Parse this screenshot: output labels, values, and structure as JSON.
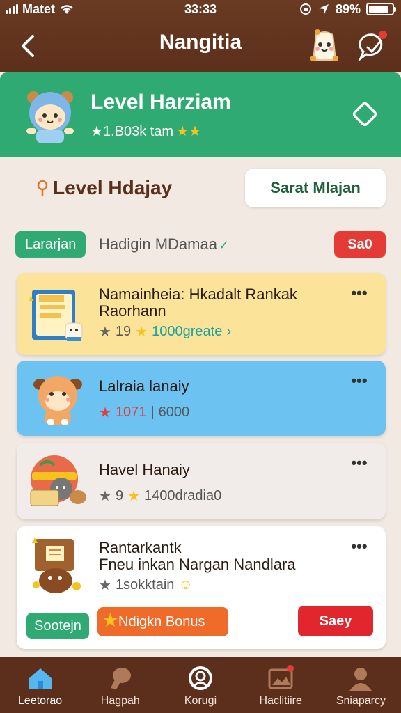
{
  "status_bar": {
    "carrier": "Matet",
    "time": "33:33",
    "battery": "89%",
    "battery_level": 0.89
  },
  "header": {
    "title": "Nangitia",
    "back_icon": "chevron-left-icon",
    "mascot_icon": "mascot-icon",
    "chat_icon": "chat-edit-icon"
  },
  "level_banner": {
    "title": "Level Harziam",
    "subtitle": "★1.B03k tam",
    "edit_icon": "diamond-edit-icon"
  },
  "section": {
    "title": "Level Hdajay",
    "start_button": "Sarat Mlajan"
  },
  "filters": {
    "chip_label": "Lararjan",
    "text": "Hadigin MDamaa",
    "badge": "Sa0"
  },
  "cards": [
    {
      "title": "Namainheia: Hkadalt Rankak",
      "subtitle": "Raorhann",
      "rating": "19",
      "extra": "1000greate",
      "bg": "#fbe39a"
    },
    {
      "title": "Lalraia lanaiy",
      "rating": "1071",
      "extra": "6000",
      "bg": "#6cc3f2"
    },
    {
      "title": "Havel Hanaiy",
      "rating": "9",
      "extra": "1400dradia0",
      "bg": "#f1ecea"
    },
    {
      "title": "Rantarkantk",
      "subtitle": "Fneu inkan Nargan Nandlara",
      "rating": "1sokktain",
      "bg": "#ffffff"
    }
  ],
  "actions": {
    "left": "Sootejn",
    "middle": "Ndigkn Bonus",
    "right": "Saey"
  },
  "tabs": [
    {
      "label": "Leetorao",
      "icon": "home-icon"
    },
    {
      "label": "Hagpah",
      "icon": "hand-icon"
    },
    {
      "label": "Korugi",
      "icon": "profile-icon"
    },
    {
      "label": "Haclitiire",
      "icon": "image-icon"
    },
    {
      "label": "Sniaparcy",
      "icon": "person-icon"
    }
  ],
  "colors": {
    "brown": "#5b2f1b",
    "green": "#2faa72",
    "red": "#e53b37",
    "orange": "#f06a2a",
    "blue": "#6cc3f2"
  }
}
